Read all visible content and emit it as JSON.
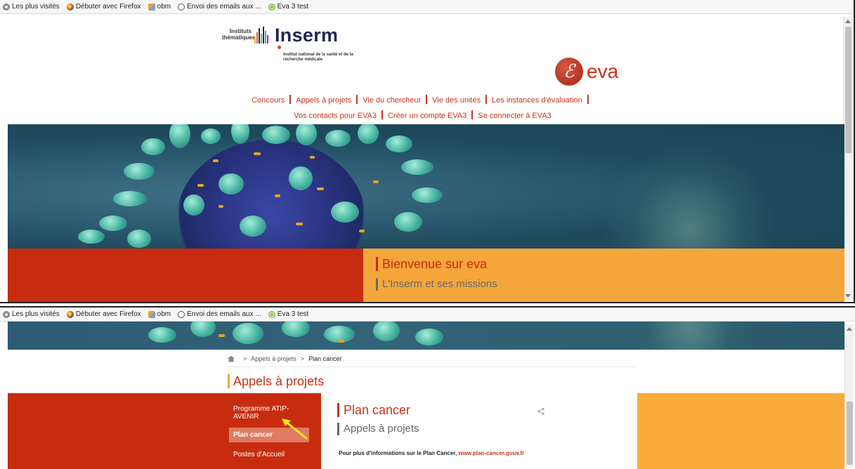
{
  "bookmarks": [
    {
      "label": "Les plus visités",
      "icon": "gear-icon"
    },
    {
      "label": "Débuter avec Firefox",
      "icon": "firefox-icon"
    },
    {
      "label": "obm",
      "icon": "obm-icon"
    },
    {
      "label": "Envoi des emails aux ...",
      "icon": "mail-icon"
    },
    {
      "label": "Eva 3 test",
      "icon": "eva-icon"
    }
  ],
  "header": {
    "institutes_label": "Instituts thématiques",
    "brand": "Inserm",
    "brand_subtitle": "Institut national de la santé et de la recherche médicale",
    "eva_glyph": "ℰ",
    "eva_wordmark": "eva"
  },
  "nav": {
    "row1": [
      "Concours",
      "Appels à projets",
      "Vie du chercheur",
      "Vie des unités",
      "Les instances d'évaluation"
    ],
    "row2": [
      "Vos contacts pour EVA3",
      "Créer un compte EVA3",
      "Se connecter à EVA3"
    ]
  },
  "band": {
    "title": "Bienvenue sur eva",
    "subtitle": "L'Inserm et ses missions"
  },
  "breadcrumb": {
    "sep": ">",
    "items": [
      "Appels à projets",
      "Plan cancer"
    ]
  },
  "page": {
    "title": "Appels à projets",
    "side_items": [
      "Programme ATIP-AVENIR",
      "Plan cancer",
      "Postes d'Accueil"
    ],
    "active_item": "Plan cancer",
    "content_title": "Plan cancer",
    "content_subtitle": "Appels à projets",
    "info_text": "Pour plus d'informations sur le Plan Cancer,",
    "info_link": "www.plan-cancer.gouv.fr"
  },
  "colors": {
    "brand_red": "#c8331c",
    "band_red": "#c82c0f",
    "band_orange": "#f4a63b",
    "inserm_navy": "#1d2a4f",
    "annotation_arrow": "#f4e81a"
  }
}
